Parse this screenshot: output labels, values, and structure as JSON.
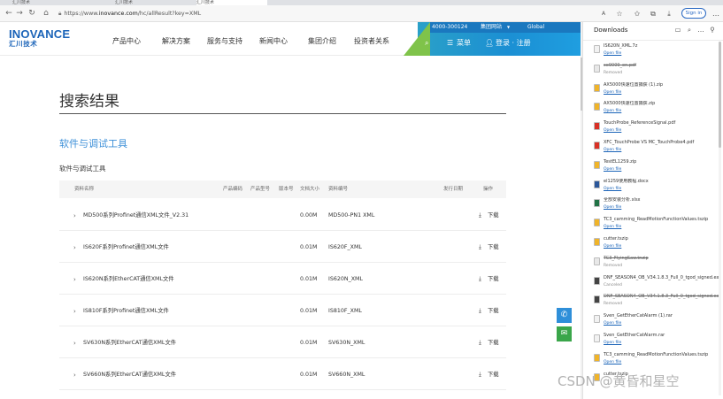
{
  "browser": {
    "tabs": [
      {
        "label": "汇川技术"
      },
      {
        "label": "汇川技术"
      },
      {
        "label": "汇川技术"
      }
    ],
    "url_prefix": "https://www.",
    "url_host": "inovance.com",
    "url_path": "/hc/allResult?key=XML",
    "signin_label": "Sign in"
  },
  "site": {
    "logo_top": "INOVANCE",
    "logo_bottom": "汇川技术",
    "nav": [
      "产品中心",
      "解决方案",
      "服务与支持",
      "新闻中心",
      "集团介绍",
      "投资者关系"
    ],
    "phone": "4000-300124",
    "group_site": "集团网站",
    "global": "Global",
    "menu_label": "菜单",
    "login_label": "登录 · 注册"
  },
  "main": {
    "page_title": "搜索结果",
    "section_title": "软件与调试工具",
    "sub_title": "软件与调试工具",
    "columns": [
      "资料名称",
      "产品编码",
      "产品型号",
      "版本号",
      "文档大小",
      "资料编号",
      "发行日期",
      "操作"
    ],
    "rows": [
      {
        "name": "MD500系列Profinet通信XML文件_V2.31",
        "size": "0.00M",
        "code": "MD500-PN1 XML",
        "action": "下载"
      },
      {
        "name": "IS620F系列Profinet通信XML文件",
        "size": "0.01M",
        "code": "IS620F_XML",
        "action": "下载"
      },
      {
        "name": "IS620N系列EtherCAT通信XML文件",
        "size": "0.01M",
        "code": "IS620N_XML",
        "action": "下载"
      },
      {
        "name": "IS810F系列Profinet通信XML文件",
        "size": "0.01M",
        "code": "IS810F_XML",
        "action": "下载"
      },
      {
        "name": "SV630N系列EtherCAT通信XML文件",
        "size": "0.01M",
        "code": "SV630N_XML",
        "action": "下载"
      },
      {
        "name": "SV660N系列EtherCAT通信XML文件",
        "size": "0.01M",
        "code": "SV660N_XML",
        "action": "下载"
      }
    ]
  },
  "downloads": {
    "title": "Downloads",
    "items": [
      {
        "name": "IS620N_XML.7z",
        "status": "Open file",
        "kind": "open",
        "color": "#f2f2f2"
      },
      {
        "name": "ce9009_en.pdf",
        "status": "Removed",
        "kind": "removed",
        "color": "#e8e8e8"
      },
      {
        "name": "AX5000快速位置捕获 (1).zip",
        "status": "Open file",
        "kind": "open",
        "color": "#f0b429"
      },
      {
        "name": "AX5000快速位置捕获.zip",
        "status": "Open file",
        "kind": "open",
        "color": "#f0b429"
      },
      {
        "name": "TouchProbe_ReferenceSignal.pdf",
        "status": "Open file",
        "kind": "open",
        "color": "#d93025"
      },
      {
        "name": "XFC_TouchProbe VS MC_TouchProbe4.pdf",
        "status": "Open file",
        "kind": "open",
        "color": "#d93025"
      },
      {
        "name": "TestEL1259.zip",
        "status": "Open file",
        "kind": "open",
        "color": "#f0b429"
      },
      {
        "name": "el1259使用教程.docx",
        "status": "Open file",
        "kind": "open",
        "color": "#2b579a"
      },
      {
        "name": "全部安装分析.xlsx",
        "status": "Open file",
        "kind": "open",
        "color": "#217346"
      },
      {
        "name": "TC3_camming_ReadMotionFunctionValues.tszip",
        "status": "Open file",
        "kind": "open",
        "color": "#f0b429"
      },
      {
        "name": "cutter.tszip",
        "status": "Open file",
        "kind": "open",
        "color": "#f0b429"
      },
      {
        "name": "TC3_FlyingSaw.tnzip",
        "status": "Removed",
        "kind": "removed",
        "color": "#e8e8e8"
      },
      {
        "name": "DNF_SEASON4_OB_V34.1.8.3_Full_0_tgod_signed.exe",
        "status": "Canceled",
        "kind": "canceled",
        "color": "#444"
      },
      {
        "name": "DNF_SEASON4_OB_V34.1.8.3_Full_0_tgod_signed.exe",
        "status": "Removed",
        "kind": "removed",
        "color": "#444"
      },
      {
        "name": "Sven_GetEtherCatAlarm (1).rar",
        "status": "Open file",
        "kind": "open",
        "color": "#f2f2f2"
      },
      {
        "name": "Sven_GetEtherCatAlarm.rar",
        "status": "Open file",
        "kind": "open",
        "color": "#f2f2f2"
      },
      {
        "name": "TC3_camming_ReadMotionFunctionValues.tszip",
        "status": "Open file",
        "kind": "open",
        "color": "#f0b429"
      },
      {
        "name": "cutter.tszip",
        "status": "",
        "kind": "open",
        "color": "#f0b429"
      }
    ]
  },
  "watermark": "CSDN @黄昏和星空"
}
